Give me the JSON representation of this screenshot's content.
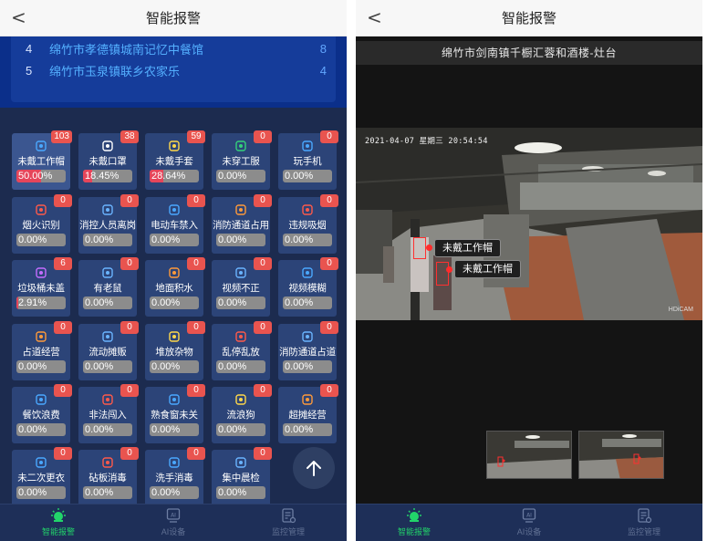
{
  "left": {
    "header": {
      "back": "<",
      "title": "智能报警"
    },
    "ranking": [
      {
        "no": "4",
        "name": "绵竹市孝德镇城南记忆中餐馆",
        "count": "8"
      },
      {
        "no": "5",
        "name": "绵竹市玉泉镇联乡农家乐",
        "count": "4"
      }
    ],
    "tiles": [
      {
        "name": "未戴工作帽",
        "badge": "103",
        "pct": "50.00%",
        "ratio": 0.5,
        "icon": "chef-hat-icon"
      },
      {
        "name": "未戴口罩",
        "badge": "38",
        "pct": "18.45%",
        "ratio": 0.1845,
        "icon": "mask-icon"
      },
      {
        "name": "未戴手套",
        "badge": "59",
        "pct": "28.64%",
        "ratio": 0.2864,
        "icon": "glove-icon"
      },
      {
        "name": "未穿工服",
        "badge": "0",
        "pct": "0.00%",
        "ratio": 0,
        "icon": "uniform-icon"
      },
      {
        "name": "玩手机",
        "badge": "0",
        "pct": "0.00%",
        "ratio": 0,
        "icon": "phone-icon"
      },
      {
        "name": "烟火识别",
        "badge": "0",
        "pct": "0.00%",
        "ratio": 0,
        "icon": "fire-icon"
      },
      {
        "name": "消控人员离岗",
        "badge": "0",
        "pct": "0.00%",
        "ratio": 0,
        "icon": "person-icon"
      },
      {
        "name": "电动车禁入",
        "badge": "0",
        "pct": "0.00%",
        "ratio": 0,
        "icon": "scooter-icon"
      },
      {
        "name": "消防通道占用",
        "badge": "0",
        "pct": "0.00%",
        "ratio": 0,
        "icon": "shield-icon"
      },
      {
        "name": "违规吸烟",
        "badge": "0",
        "pct": "0.00%",
        "ratio": 0,
        "icon": "cigarette-icon"
      },
      {
        "name": "垃圾桶未盖",
        "badge": "6",
        "pct": "2.91%",
        "ratio": 0.0291,
        "icon": "trash-icon"
      },
      {
        "name": "有老鼠",
        "badge": "0",
        "pct": "0.00%",
        "ratio": 0,
        "icon": "mouse-icon"
      },
      {
        "name": "地面积水",
        "badge": "0",
        "pct": "0.00%",
        "ratio": 0,
        "icon": "water-drop-icon"
      },
      {
        "name": "视频不正",
        "badge": "0",
        "pct": "0.00%",
        "ratio": 0,
        "icon": "camera-icon"
      },
      {
        "name": "视频模糊",
        "badge": "0",
        "pct": "0.00%",
        "ratio": 0,
        "icon": "blur-icon"
      },
      {
        "name": "占道经营",
        "badge": "0",
        "pct": "0.00%",
        "ratio": 0,
        "icon": "stall-icon"
      },
      {
        "name": "流动摊贩",
        "badge": "0",
        "pct": "0.00%",
        "ratio": 0,
        "icon": "vendor-icon"
      },
      {
        "name": "堆放杂物",
        "badge": "0",
        "pct": "0.00%",
        "ratio": 0,
        "icon": "pile-icon"
      },
      {
        "name": "乱停乱放",
        "badge": "0",
        "pct": "0.00%",
        "ratio": 0,
        "icon": "no-parking-icon"
      },
      {
        "name": "消防通道占道",
        "badge": "0",
        "pct": "0.00%",
        "ratio": 0,
        "icon": "road-icon"
      },
      {
        "name": "餐饮浪费",
        "badge": "0",
        "pct": "0.00%",
        "ratio": 0,
        "icon": "bowl-icon"
      },
      {
        "name": "非法闯入",
        "badge": "0",
        "pct": "0.00%",
        "ratio": 0,
        "icon": "intruder-icon"
      },
      {
        "name": "熟食窗未关",
        "badge": "0",
        "pct": "0.00%",
        "ratio": 0,
        "icon": "window-icon"
      },
      {
        "name": "流浪狗",
        "badge": "0",
        "pct": "0.00%",
        "ratio": 0,
        "icon": "dog-icon"
      },
      {
        "name": "超摊经营",
        "badge": "0",
        "pct": "0.00%",
        "ratio": 0,
        "icon": "booth-icon"
      },
      {
        "name": "未二次更衣",
        "badge": "0",
        "pct": "0.00%",
        "ratio": 0,
        "icon": "shirt-icon"
      },
      {
        "name": "砧板消毒",
        "badge": "0",
        "pct": "0.00%",
        "ratio": 0,
        "icon": "board-icon"
      },
      {
        "name": "洗手消毒",
        "badge": "0",
        "pct": "0.00%",
        "ratio": 0,
        "icon": "handwash-icon"
      },
      {
        "name": "集中晨检",
        "badge": "0",
        "pct": "0.00%",
        "ratio": 0,
        "icon": "checkup-icon"
      }
    ],
    "nav": [
      {
        "label": "智能报警",
        "icon": "alarm-icon",
        "active": true
      },
      {
        "label": "AI设备",
        "icon": "ai-device-icon",
        "active": false
      },
      {
        "label": "监控管理",
        "icon": "monitor-icon",
        "active": false
      }
    ]
  },
  "right": {
    "header": {
      "back": "<",
      "title": "智能报警"
    },
    "camera_title": "绵竹市剑南镇千橱汇蓉和酒楼-灶台",
    "timestamp": "2021-04-07 星期三 20:54:54",
    "brand": "HDiCAM",
    "detections": [
      "未戴工作帽",
      "未戴工作帽"
    ],
    "nav": [
      {
        "label": "智能报警",
        "icon": "alarm-icon",
        "active": true
      },
      {
        "label": "AI设备",
        "icon": "ai-device-icon",
        "active": false
      },
      {
        "label": "监控管理",
        "icon": "monitor-icon",
        "active": false
      }
    ]
  },
  "colors": {
    "accent_red": "#e9544f",
    "active_green": "#22d46a",
    "panel_blue": "#1c2b4f"
  }
}
